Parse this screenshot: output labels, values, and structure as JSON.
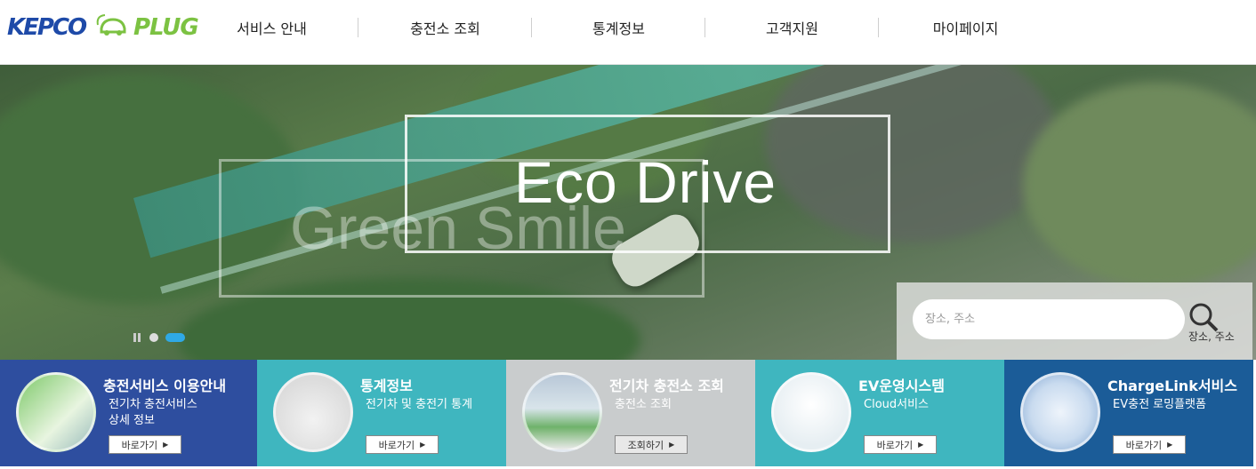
{
  "header": {
    "logo_left": "KEPCO",
    "logo_right": "PLUG",
    "nav": [
      "서비스 안내",
      "충전소 조회",
      "통계정보",
      "고객지원",
      "마이페이지"
    ]
  },
  "hero": {
    "headline": "Eco Drive",
    "subheadline": "Green Smile",
    "search": {
      "placeholder": "장소, 주소",
      "button_label": "장소, 주소"
    }
  },
  "cards": [
    {
      "title": "충전서비스 이용안내",
      "desc_line1": "전기차 충전서비스",
      "desc_line2": "상세 정보",
      "button": "바로가기"
    },
    {
      "title": "통계정보",
      "desc_line1": "전기차 및 충전기 통계",
      "desc_line2": "",
      "button": "바로가기"
    },
    {
      "title": "전기차 충전소 조회",
      "desc_line1": "충전소 조회",
      "desc_line2": "",
      "button": "조회하기"
    },
    {
      "title": "EV운영시스템",
      "desc_line1": "Cloud서비스",
      "desc_line2": "",
      "button": "바로가기"
    },
    {
      "title": "ChargeLink서비스",
      "desc_line1": "EV충전 로밍플랫폼",
      "desc_line2": "",
      "button": "바로가기"
    }
  ],
  "colors": {
    "card1": "#2e4e9f",
    "card2": "#3fb6bf",
    "card3": "#c9cccd",
    "card4": "#3fb6bf",
    "card5": "#1b5c98",
    "slider_active": "#2fa9e6"
  }
}
